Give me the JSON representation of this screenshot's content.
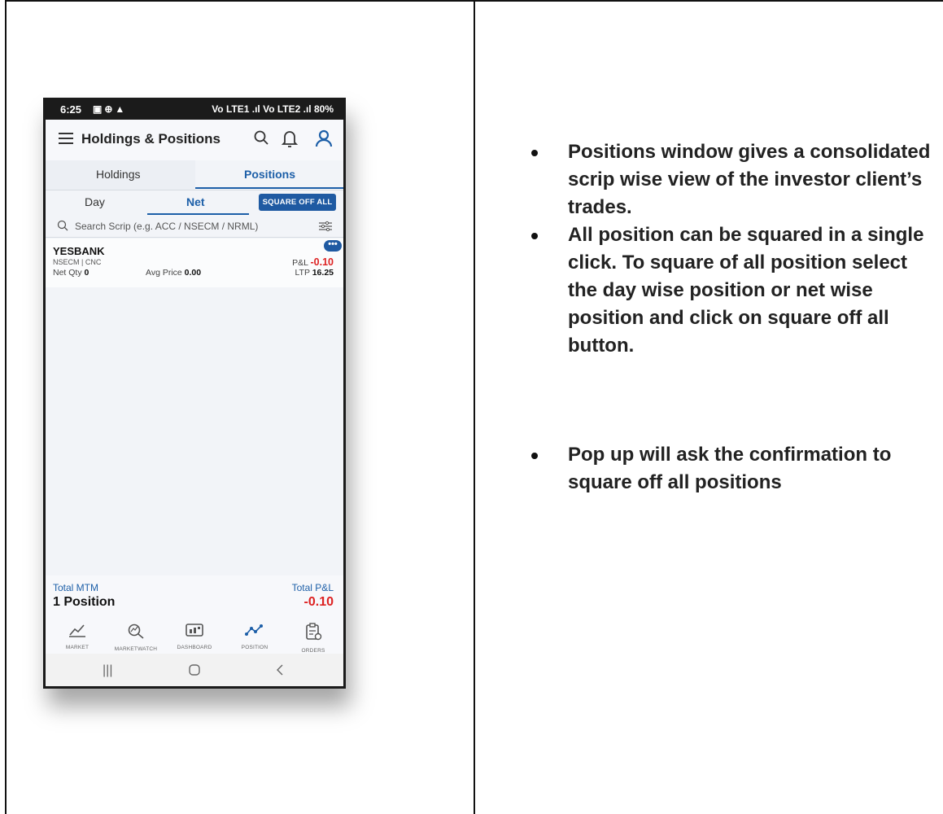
{
  "phone": {
    "status": {
      "time": "6:25",
      "right": "Vo LTE1 .ıl Vo LTE2 .ıl 80%"
    },
    "app_title": "Holdings & Positions",
    "tabs": {
      "holdings": "Holdings",
      "positions": "Positions"
    },
    "subtabs": {
      "day": "Day",
      "net": "Net",
      "square_off": "SQUARE OFF ALL"
    },
    "search_placeholder": "Search Scrip (e.g. ACC / NSECM / NRML)",
    "position": {
      "symbol": "YESBANK",
      "exchange": "NSECM | CNC",
      "net_qty_label": "Net Qty",
      "net_qty": "0",
      "avg_label": "Avg Price",
      "avg": "0.00",
      "pl_label": "P&L",
      "pl": "-0.10",
      "ltp_label": "LTP",
      "ltp": "16.25",
      "more": "•••"
    },
    "totals": {
      "mtm_label": "Total MTM",
      "count": "1 Position",
      "pl_label": "Total P&L",
      "pl": "-0.10"
    },
    "nav": [
      "MARKET",
      "MARKETWATCH",
      "DASHBOARD",
      "POSITION",
      "ORDERS"
    ],
    "colors": {
      "accent": "#1d5fa8",
      "loss": "#dd2222"
    }
  },
  "notes": {
    "items": [
      "Positions window gives a consolidated scrip wise view of the investor client’s trades.",
      "All position can be squared in a single click. To square of all position select the day wise position or net wise position and click on square off all button.",
      "Pop up will ask the confirmation to square off all positions"
    ]
  }
}
